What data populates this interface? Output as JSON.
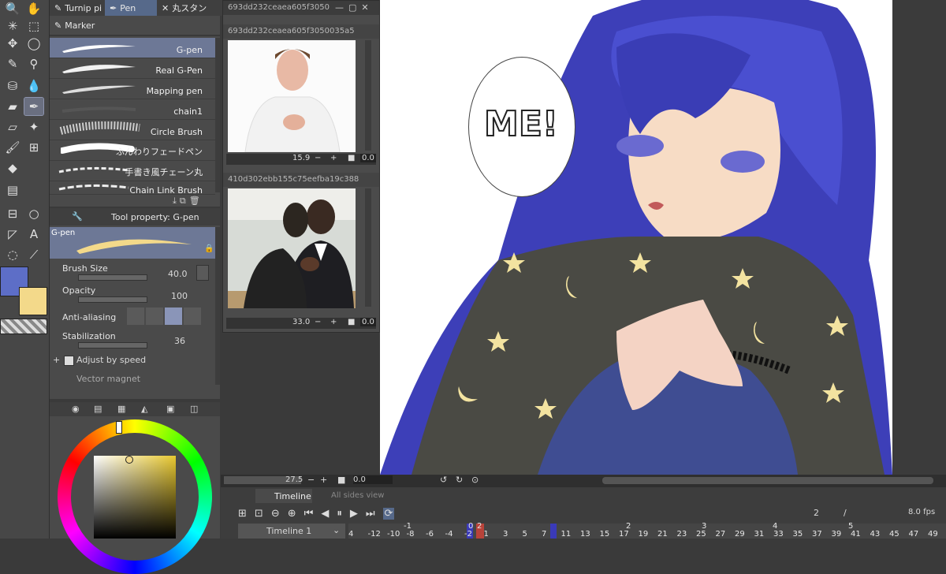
{
  "toolbar": {
    "tools": [
      "magnifier-icon",
      "hand-icon",
      "magic-wand-icon",
      "operation-icon",
      "move-icon",
      "lasso-icon",
      "pen-icon",
      "eyedropper-icon",
      "fill-icon",
      "drop-icon",
      "eraser-icon",
      "pen-tool-icon",
      "eraser2-icon",
      "sparkle-icon",
      "brush-icon",
      "grid-icon",
      "bucket-icon",
      "gradient-icon",
      "frame-icon",
      "ellipse-icon",
      "ruler-icon",
      "text-icon",
      "balloon-icon",
      "correction-icon"
    ]
  },
  "subtool": {
    "tabs": [
      "Turnip pi",
      "Pen",
      "丸スタン"
    ],
    "group": "Marker",
    "brushes": [
      {
        "label": "G-pen",
        "active": true
      },
      {
        "label": "Real G-Pen",
        "active": false
      },
      {
        "label": "Mapping pen",
        "active": false
      },
      {
        "label": "chain1",
        "active": false
      },
      {
        "label": "Circle Brush",
        "active": false
      },
      {
        "label": "ふんわりフェードペン",
        "active": false
      },
      {
        "label": "手書き風チェーン丸",
        "active": false
      },
      {
        "label": "Chain Link Brush",
        "active": false
      }
    ]
  },
  "toolprop": {
    "title": "Tool property: G-pen",
    "preview_label": "G-pen",
    "brush_size_label": "Brush Size",
    "brush_size_value": "40.0",
    "opacity_label": "Opacity",
    "opacity_value": "100",
    "antialias_label": "Anti-aliasing",
    "stabilization_label": "Stabilization",
    "stabilization_value": "36",
    "adjust_label": "Adjust by speed",
    "vector_label": "Vector magnet"
  },
  "colors": {
    "main": "#5d6ec7",
    "sub": "#f3d98a",
    "accent": "#56698a"
  },
  "reference": {
    "window_title": "693dd232ceaea605f3050",
    "ref1_title": "693dd232ceaea605f3050035a5",
    "ref1_zoom": "15.9",
    "ref1_angle": "0.0",
    "ref2_title": "410d302ebb155c75eefba19c388",
    "ref2_zoom": "33.0",
    "ref2_angle": "0.0"
  },
  "canvas": {
    "bubble_text": "ME!",
    "zoom": "27.5",
    "angle": "0.0"
  },
  "timeline": {
    "tab1": "Timeline",
    "tab2": "All sides view",
    "track_name": "Timeline 1",
    "current_frame": "2",
    "separator": "/",
    "fps": "8.0 fps",
    "frame_labels_top": [
      "-1",
      "0",
      "2",
      "2",
      "3",
      "4",
      "5"
    ],
    "frame_labels_bottom": [
      "4",
      "-12",
      "-10",
      "-8",
      "-6",
      "-4",
      "-2",
      "1",
      "3",
      "5",
      "7",
      "11",
      "13",
      "15",
      "17",
      "19",
      "21",
      "23",
      "25",
      "27",
      "29",
      "31",
      "33",
      "35",
      "37",
      "39",
      "41",
      "43",
      "45",
      "47",
      "49"
    ]
  }
}
